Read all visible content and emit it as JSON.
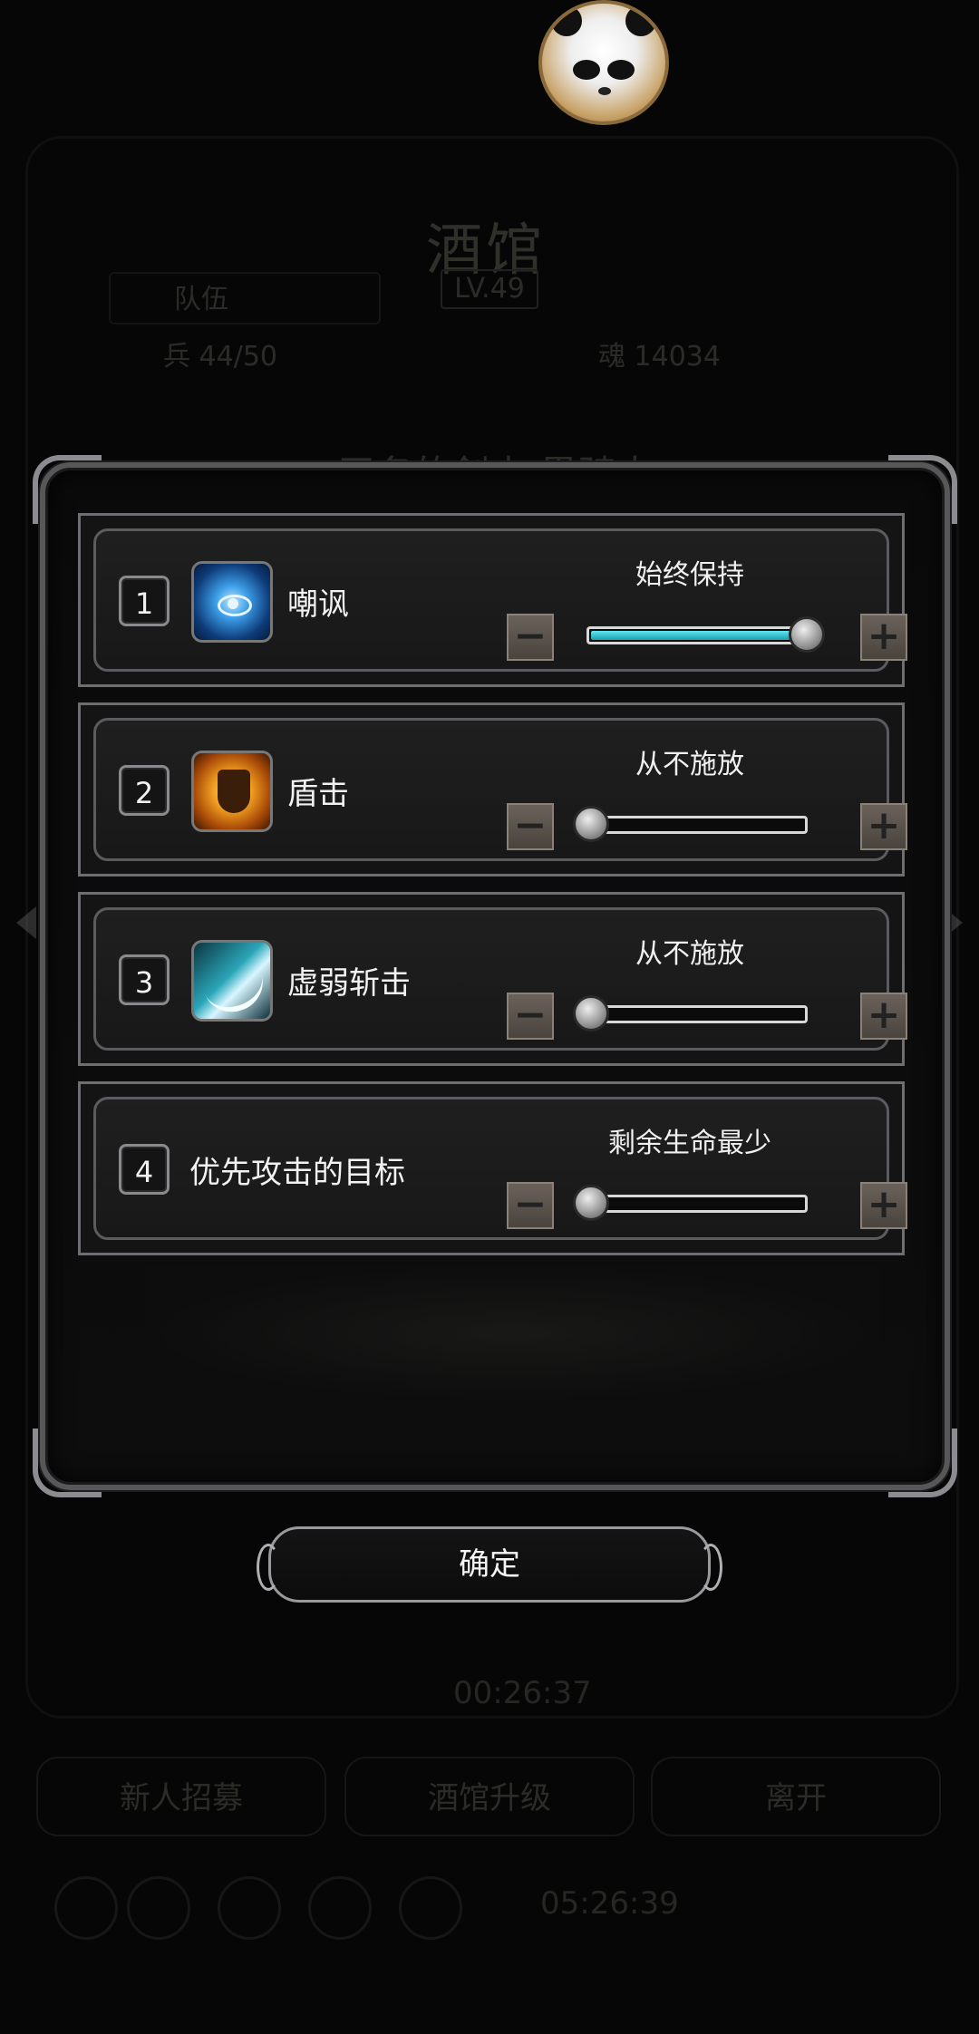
{
  "background": {
    "title": "酒馆",
    "level": "LV.49",
    "tab": "队伍",
    "stat_left": "兵 44/50",
    "stat_right": "魂 14034",
    "hero_name": "无名的剑士 黑骑士",
    "timer": "00:26:37",
    "buttons": [
      "新人招募",
      "酒馆升级",
      "离开"
    ],
    "bottom_timer": "05:26:39"
  },
  "dialog": {
    "rows": [
      {
        "index": "1",
        "icon": "taunt-eye-icon",
        "name": "嘲讽",
        "state": "始终保持",
        "level": 1.0
      },
      {
        "index": "2",
        "icon": "shield-bash-icon",
        "name": "盾击",
        "state": "从不施放",
        "level": 0.0
      },
      {
        "index": "3",
        "icon": "weak-slash-icon",
        "name": "虚弱斩击",
        "state": "从不施放",
        "level": 0.0
      },
      {
        "index": "4",
        "icon": "",
        "name": "优先攻击的目标",
        "state": "剩余生命最少",
        "level": 0.0
      }
    ],
    "minus_symbol": "−",
    "plus_symbol": "+",
    "confirm_label": "确定"
  },
  "colors": {
    "slider_fill": "#2ab8c8",
    "frame": "#57575a"
  }
}
